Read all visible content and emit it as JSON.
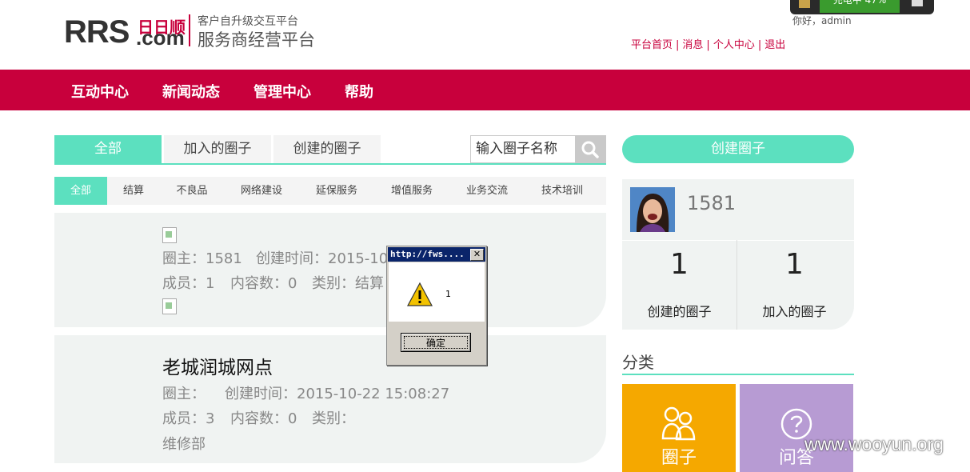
{
  "header": {
    "logo_text_black": "RRS",
    "logo_text_red": "日日顺",
    "logo_text_com": ".com",
    "logo_subtitle1": "客户自升级交互平台",
    "logo_subtitle2": "服务商经营平台",
    "notification_text": "充电中 47%",
    "greeting": "你好，admin",
    "links": [
      "平台首页",
      "消息",
      "个人中心",
      "退出"
    ]
  },
  "nav": [
    "互动中心",
    "新闻动态",
    "管理中心",
    "帮助"
  ],
  "tabs": [
    "全部",
    "加入的圈子",
    "创建的圈子"
  ],
  "search": {
    "placeholder": "输入圈子名称"
  },
  "subtabs": [
    "全部",
    "结算",
    "不良品",
    "网络建设",
    "延保服务",
    "增值服务",
    "业务交流",
    "技术培训"
  ],
  "cards": [
    {
      "owner": "圈主：1581",
      "created": "创建时间：2015-10",
      "members": "成员：1",
      "contents": "内容数：0",
      "category": "类别：结算"
    },
    {
      "title": "老城润城网点",
      "owner": "圈主：",
      "created": "创建时间：2015-10-22 15:08:27",
      "members": "成员：3",
      "contents": "内容数：0",
      "category": "类别：",
      "category_value": "维修部"
    }
  ],
  "sidebar": {
    "create_button": "创建圈子",
    "username": "1581",
    "stats": [
      {
        "value": "1",
        "label": "创建的圈子"
      },
      {
        "value": "1",
        "label": "加入的圈子"
      }
    ],
    "category_title": "分类",
    "tiles": [
      {
        "label": "圈子",
        "color": "#f5a800",
        "icon": "people-icon"
      },
      {
        "label": "问答",
        "color": "#b79bd3",
        "icon": "question-icon"
      }
    ]
  },
  "dialog": {
    "title": "http://fws....",
    "message": "1",
    "ok_label": "确定"
  },
  "watermark": "www.wooyun.org",
  "colors": {
    "brand_red": "#c8003c",
    "accent_mint": "#5ce0bf"
  }
}
